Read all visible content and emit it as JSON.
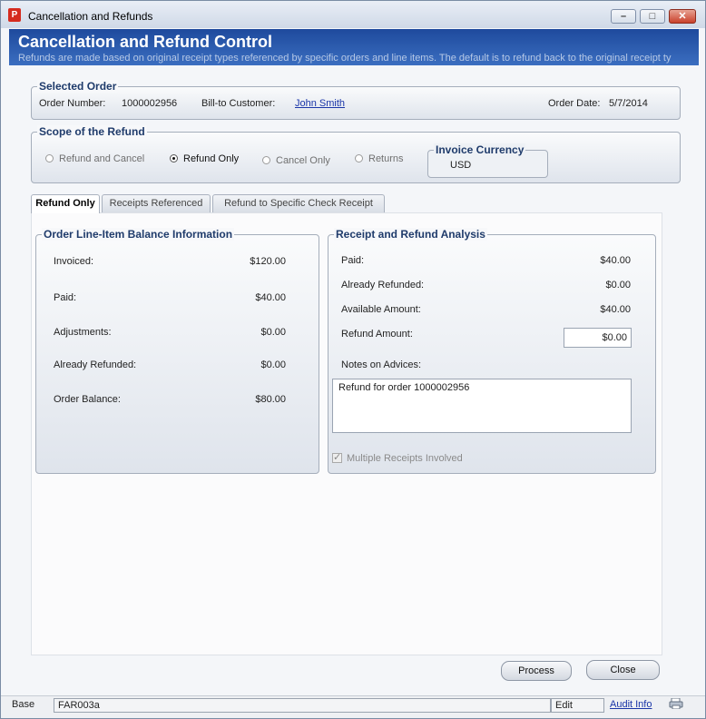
{
  "window": {
    "title": "Cancellation and Refunds",
    "app_icon_glyph": "P",
    "controls": {
      "minimize": "–",
      "maximize": "□",
      "close": "✕"
    }
  },
  "header": {
    "title": "Cancellation and Refund Control",
    "subtitle": "Refunds are made based on original receipt types referenced by specific orders and line items. The default is to refund back to the original receipt ty"
  },
  "selected_order": {
    "legend": "Selected Order",
    "order_number_label": "Order Number:",
    "order_number": "1000002956",
    "bill_to_label": "Bill-to Customer:",
    "bill_to_customer": "John Smith",
    "order_date_label": "Order Date:",
    "order_date": "5/7/2014"
  },
  "scope": {
    "legend": "Scope of the Refund",
    "options": [
      {
        "label": "Refund and Cancel",
        "selected": false
      },
      {
        "label": "Refund Only",
        "selected": true
      },
      {
        "label": "Cancel Only",
        "selected": false
      },
      {
        "label": "Returns",
        "selected": false
      }
    ],
    "currency_legend": "Invoice Currency",
    "currency": "USD"
  },
  "tabs": [
    {
      "label": "Refund Only",
      "active": true
    },
    {
      "label": "Receipts Referenced",
      "active": false
    },
    {
      "label": "Refund to Specific Check Receipt",
      "active": false
    }
  ],
  "balance": {
    "legend": "Order Line-Item Balance Information",
    "rows": [
      {
        "label": "Invoiced:",
        "value": "$120.00"
      },
      {
        "label": "Paid:",
        "value": "$40.00"
      },
      {
        "label": "Adjustments:",
        "value": "$0.00"
      },
      {
        "label": "Already Refunded:",
        "value": "$0.00"
      },
      {
        "label": "Order Balance:",
        "value": "$80.00"
      }
    ]
  },
  "analysis": {
    "legend": "Receipt and Refund Analysis",
    "rows": [
      {
        "label": "Paid:",
        "value": "$40.00"
      },
      {
        "label": "Already Refunded:",
        "value": "$0.00"
      },
      {
        "label": "Available Amount:",
        "value": "$40.00"
      }
    ],
    "refund_amount_label": "Refund Amount:",
    "refund_amount": "$0.00",
    "notes_label": "Notes on Advices:",
    "notes": "Refund for order 1000002956",
    "multiple_receipts_label": "Multiple Receipts Involved",
    "multiple_receipts_checked": true
  },
  "buttons": {
    "process": "Process",
    "close": "Close"
  },
  "status_bar": {
    "base_label": "Base",
    "form_id": "FAR003a",
    "mode": "Edit",
    "audit_link": "Audit Info"
  }
}
